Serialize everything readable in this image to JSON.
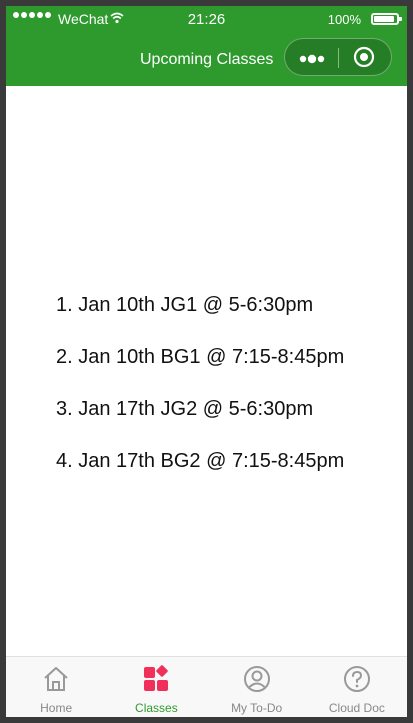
{
  "status_bar": {
    "carrier": "WeChat",
    "time": "21:26",
    "battery": "100%",
    "battery_level": 1.0
  },
  "nav": {
    "title": "Upcoming Classes",
    "more_icon": "more-dots-icon",
    "close_icon": "target-close-icon"
  },
  "classes": [
    "1. Jan 10th JG1 @ 5-6:30pm",
    "2. Jan 10th BG1 @ 7:15-8:45pm",
    "3. Jan 17th JG2 @ 5-6:30pm",
    "4. Jan 17th BG2 @ 7:15-8:45pm"
  ],
  "tabs": [
    {
      "label": "Home",
      "icon": "home-icon"
    },
    {
      "label": "Classes",
      "icon": "classes-grid-icon",
      "active": true
    },
    {
      "label": "My To-Do",
      "icon": "user-circle-icon"
    },
    {
      "label": "Cloud Doc",
      "icon": "help-circle-icon"
    }
  ],
  "colors": {
    "brand_green": "#2e9a2e",
    "active_icon": "#f0305a",
    "inactive_icon": "#999999"
  }
}
